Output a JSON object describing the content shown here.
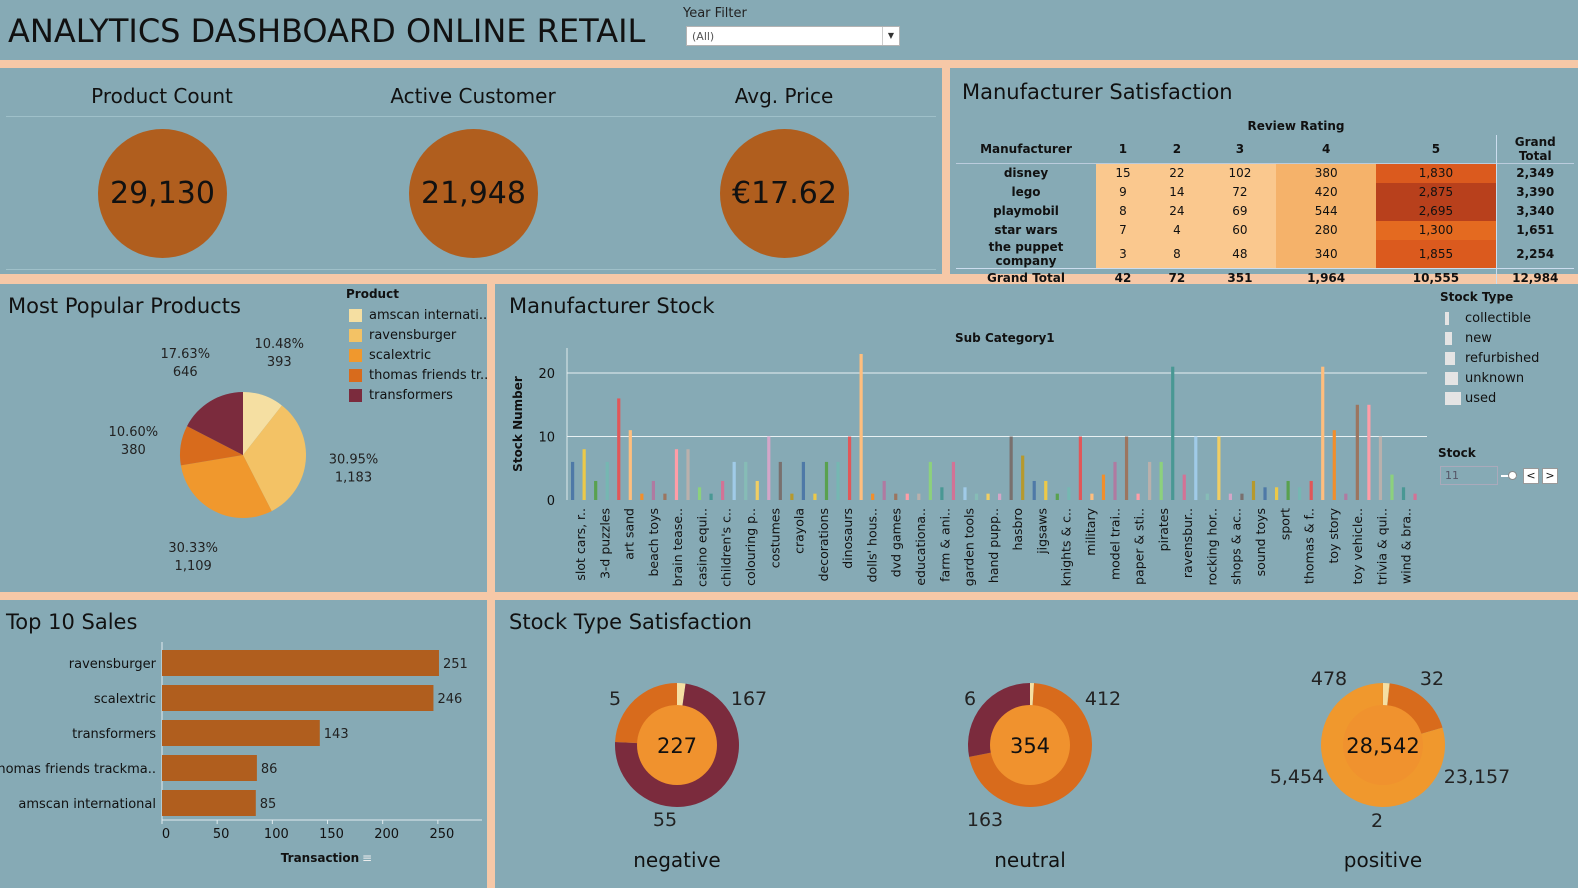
{
  "header": {
    "title": "ANALYTICS DASHBOARD ONLINE RETAIL",
    "filter_label": "Year Filter",
    "filter_value": "(All)"
  },
  "kpis": [
    {
      "label": "Product Count",
      "value": "29,130"
    },
    {
      "label": "Active Customer",
      "value": "21,948"
    },
    {
      "label": "Avg. Price",
      "value": "€17.62"
    }
  ],
  "satisfaction": {
    "title": "Manufacturer Satisfaction",
    "column_group": "Review Rating",
    "headers": [
      "Manufacturer",
      "1",
      "2",
      "3",
      "4",
      "5",
      "Grand Total"
    ],
    "rows": [
      {
        "name": "disney",
        "values": [
          "15",
          "22",
          "102",
          "380",
          "1,830"
        ],
        "total": "2,349"
      },
      {
        "name": "lego",
        "values": [
          "9",
          "14",
          "72",
          "420",
          "2,875"
        ],
        "total": "3,390"
      },
      {
        "name": "playmobil",
        "values": [
          "8",
          "24",
          "69",
          "544",
          "2,695"
        ],
        "total": "3,340"
      },
      {
        "name": "star wars",
        "values": [
          "7",
          "4",
          "60",
          "280",
          "1,300"
        ],
        "total": "1,651"
      },
      {
        "name": "the puppet company",
        "values": [
          "3",
          "8",
          "48",
          "340",
          "1,855"
        ],
        "total": "2,254"
      }
    ],
    "grand_total": {
      "name": "Grand Total",
      "values": [
        "42",
        "72",
        "351",
        "1,964",
        "10,555"
      ],
      "total": "12,984"
    }
  },
  "popular": {
    "title": "Most Popular Products",
    "legend_title": "Product",
    "legend": [
      {
        "label": "amscan internati..",
        "color": "#F5DFA2"
      },
      {
        "label": "ravensburger",
        "color": "#F3C265"
      },
      {
        "label": "scalextric",
        "color": "#F0982D"
      },
      {
        "label": "thomas friends tr..",
        "color": "#D86B1C"
      },
      {
        "label": "transformers",
        "color": "#7B2B3D"
      }
    ]
  },
  "stock": {
    "title": "Manufacturer Stock",
    "legend_title": "Stock Type",
    "legend": [
      "collectible",
      "new",
      "refurbished",
      "unknown",
      "used"
    ],
    "stock_label": "Stock",
    "stock_value": "11"
  },
  "top10": {
    "title": "Top 10 Sales"
  },
  "stock_type": {
    "title": "Stock Type Satisfaction",
    "donuts": [
      {
        "label": "negative",
        "center": "227",
        "labels": [
          "5",
          "167",
          "55"
        ]
      },
      {
        "label": "neutral",
        "center": "354",
        "labels": [
          "6",
          "412",
          "163"
        ]
      },
      {
        "label": "positive",
        "center": "28,542",
        "labels": [
          "478",
          "32",
          "5,454",
          "23,157",
          "2"
        ]
      }
    ]
  },
  "chart_data": [
    {
      "type": "pie",
      "title": "Most Popular Products",
      "slices": [
        {
          "name": "amscan internati..",
          "value": 393,
          "label": "10.48%",
          "color": "#F5DFA2"
        },
        {
          "name": "ravensburger",
          "value": 1183,
          "label": "30.95%",
          "color": "#F3C265"
        },
        {
          "name": "scalextric",
          "value": 1109,
          "label": "30.33%",
          "color": "#F0982D"
        },
        {
          "name": "thomas friends tr..",
          "value": 380,
          "label": "10.60%",
          "color": "#D86B1C"
        },
        {
          "name": "transformers",
          "value": 646,
          "label": "17.63%",
          "color": "#7B2B3D"
        }
      ]
    },
    {
      "type": "bar",
      "title": "Manufacturer Stock",
      "subtitle": "Sub Category1",
      "ylabel": "Stock Number",
      "ylim": [
        0,
        23
      ],
      "yticks": [
        0,
        10,
        20
      ],
      "values": [
        6,
        8,
        3,
        6,
        16,
        11,
        1,
        3,
        1,
        8,
        8,
        2,
        1,
        3,
        6,
        6,
        3,
        10,
        6,
        1,
        6,
        1,
        6,
        6,
        10,
        23,
        1,
        3,
        1,
        1,
        1,
        6,
        2,
        6,
        2,
        1,
        1,
        1,
        10,
        7,
        3,
        3,
        1,
        2,
        10,
        1,
        4,
        6,
        10,
        1,
        6,
        6,
        21,
        4,
        10,
        1,
        10,
        1,
        1,
        3,
        2,
        2,
        3,
        2,
        3,
        21,
        11,
        1,
        15,
        15,
        10,
        4,
        2,
        1
      ],
      "colors": [
        "#4E79A7",
        "#EDC948",
        "#59A14F",
        "#76B7B2",
        "#E15759",
        "#FFBE7D",
        "#F28E2B",
        "#B07AA1",
        "#9C755F",
        "#FF9DA7",
        "#BAB0AC",
        "#8CD17D",
        "#499894",
        "#D37295",
        "#A0CBE8",
        "#86BCB6",
        "#F1CE63",
        "#D4A6C8",
        "#79706E",
        "#B6992D"
      ],
      "tick_labels": [
        "slot cars, r..",
        "3-d puzzles",
        "art sand",
        "beach toys",
        "brain tease..",
        "casino equi..",
        "children's c..",
        "colouring p..",
        "costumes",
        "crayola",
        "decorations",
        "dinosaurs",
        "dolls' hous..",
        "dvd games",
        "educationa..",
        "farm & ani..",
        "garden tools",
        "hand pupp..",
        "hasbro",
        "jigsaws",
        "knights & c..",
        "military",
        "model trai..",
        "paper & sti..",
        "pirates",
        "ravensbur..",
        "rocking hor..",
        "shops & ac..",
        "sound toys",
        "sport",
        "thomas & f..",
        "toy story",
        "toy vehicle..",
        "trivia & qui..",
        "wind & bra.."
      ]
    },
    {
      "type": "bar",
      "title": "Top 10 Sales",
      "orientation": "horizontal",
      "categories": [
        "ravensburger",
        "scalextric",
        "transformers",
        "thomas friends trackma..",
        "amscan international"
      ],
      "values": [
        251,
        246,
        143,
        86,
        85
      ],
      "xlabel": "Transaction",
      "xlim": [
        0,
        290
      ],
      "xticks": [
        0,
        50,
        100,
        150,
        200,
        250
      ],
      "color": "#B05E1E"
    },
    {
      "type": "pie",
      "title": "Stock Type Satisfaction",
      "donuts": [
        {
          "name": "negative",
          "total": 227,
          "slices": [
            {
              "value": 5,
              "color": "#F5DFA2"
            },
            {
              "value": 167,
              "color": "#7B2B3D"
            },
            {
              "value": 55,
              "color": "#D86B1C"
            }
          ]
        },
        {
          "name": "neutral",
          "total": 354,
          "slices": [
            {
              "value": 6,
              "color": "#F5DFA2"
            },
            {
              "value": 412,
              "color": "#D86B1C"
            },
            {
              "value": 163,
              "color": "#7B2B3D"
            }
          ]
        },
        {
          "name": "positive",
          "total": 28542,
          "slices": [
            {
              "value": 478,
              "color": "#F5DFA2"
            },
            {
              "value": 32,
              "color": "#F3C265"
            },
            {
              "value": 5454,
              "color": "#D86B1C"
            },
            {
              "value": 23157,
              "color": "#F0982D"
            },
            {
              "value": 2,
              "color": "#7B2B3D"
            }
          ]
        }
      ]
    }
  ]
}
